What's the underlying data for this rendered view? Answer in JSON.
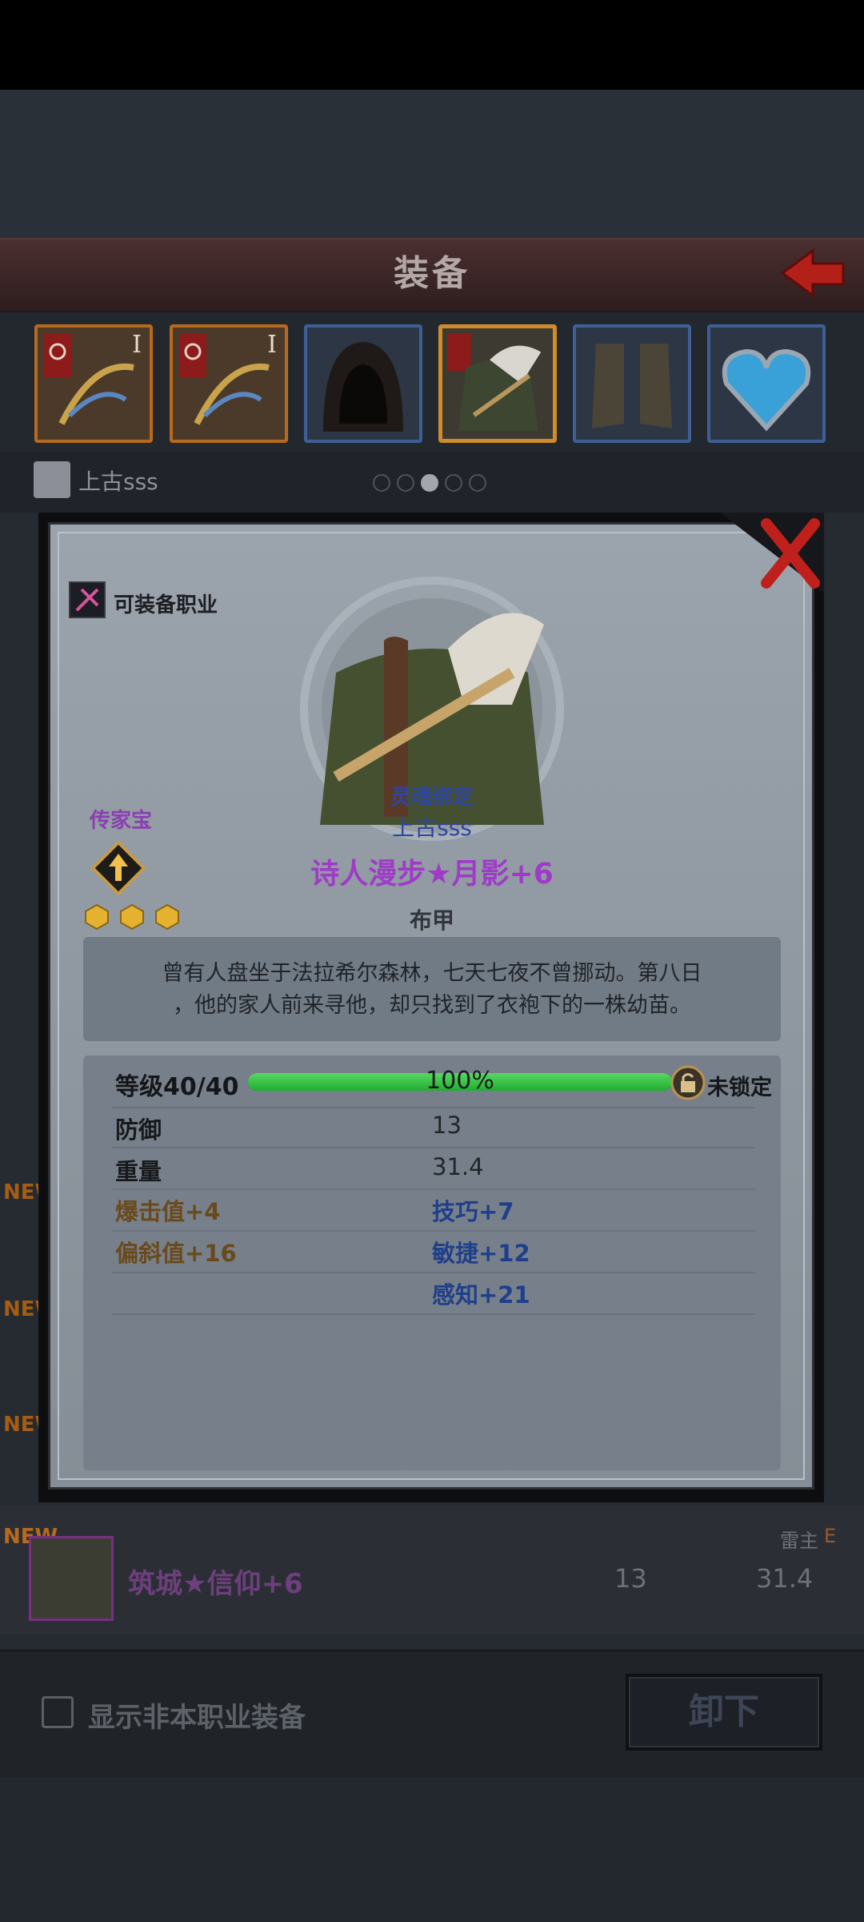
{
  "header": {
    "title": "装备"
  },
  "slots": [
    {
      "name": "weapon-slot-1",
      "rank": "I"
    },
    {
      "name": "weapon-slot-2",
      "rank": "I"
    },
    {
      "name": "hood-slot",
      "rank": ""
    },
    {
      "name": "armor-slot",
      "rank": ""
    },
    {
      "name": "boots-slot",
      "rank": ""
    },
    {
      "name": "amulet-slot",
      "rank": ""
    }
  ],
  "owner": {
    "name": "上古sss"
  },
  "page_dots": {
    "count": 5,
    "active": 2
  },
  "modal": {
    "class_label": "可装备职业",
    "heirloom_label": "传家宝",
    "heirloom_stars": 3,
    "soulbound": "灵魂绑定",
    "bound_owner": "上古sss",
    "item_name": "诗人漫步★月影+6",
    "item_type": "布甲",
    "description_line1": "曾有人盘坐于法拉希尔森林，七天七夜不曾挪动。第八日",
    "description_line2": "，他的家人前来寻他，却只找到了衣袍下的一株幼苗。",
    "level_label": "等级40/40",
    "level_progress": 1.0,
    "level_percent": "100%",
    "lock_label": "未锁定",
    "defense_label": "防御",
    "defense_value": "13",
    "weight_label": "重量",
    "weight_value": "31.4",
    "bonus_crit": "爆击值+4",
    "bonus_deflect": "偏斜值+16",
    "bonus_skill": "技巧+7",
    "bonus_agility": "敏捷+12",
    "bonus_perception": "感知+21"
  },
  "list": {
    "new_tag": "NEW",
    "item_name": "筑城★信仰+6",
    "item_defense": "13",
    "item_weight": "31.4",
    "item_class": "雷主",
    "item_class_grade": "E"
  },
  "footer": {
    "show_non_class_label": "显示非本职业装备",
    "unequip_label": "卸下"
  },
  "colors": {
    "accent_purple": "#9f3cc7",
    "progress_green": "#2fbf3d",
    "close_red": "#c0201c"
  }
}
